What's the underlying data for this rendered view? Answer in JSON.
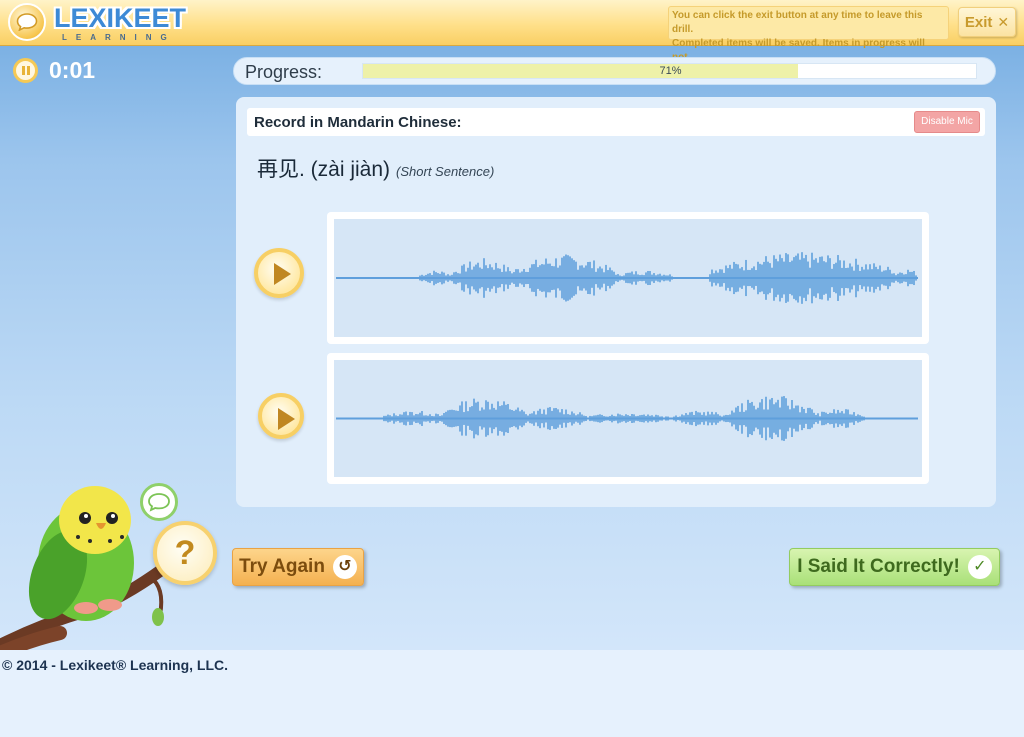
{
  "header": {
    "logo_main": "LEXIKEET",
    "logo_sub": "LEARNING",
    "exit_note_line1": "You can click the exit button at any time to leave this drill.",
    "exit_note_line2": "Completed items will be saved. Items in progress will not.",
    "exit_label": "Exit"
  },
  "timer": {
    "value": "0:01"
  },
  "progress": {
    "label": "Progress:",
    "percent_text": "71%",
    "percent": 71
  },
  "drill": {
    "instruction": "Record in Mandarin Chinese:",
    "disable_mic_label": "Disable Mic",
    "phrase": "再见. (zài jiàn)",
    "phrase_type": "(Short Sentence)"
  },
  "actions": {
    "try_again_label": "Try Again",
    "said_correctly_label": "I Said It Correctly!",
    "help_label": "?"
  },
  "footer": {
    "copyright": "© 2014 - Lexikeet® Learning, LLC."
  },
  "colors": {
    "header_bg": "#ffe08a",
    "brand_blue": "#3d8ad6",
    "wave": "#5f9fdc",
    "try_again": "#f4b150",
    "said_correctly": "#a9e078"
  }
}
